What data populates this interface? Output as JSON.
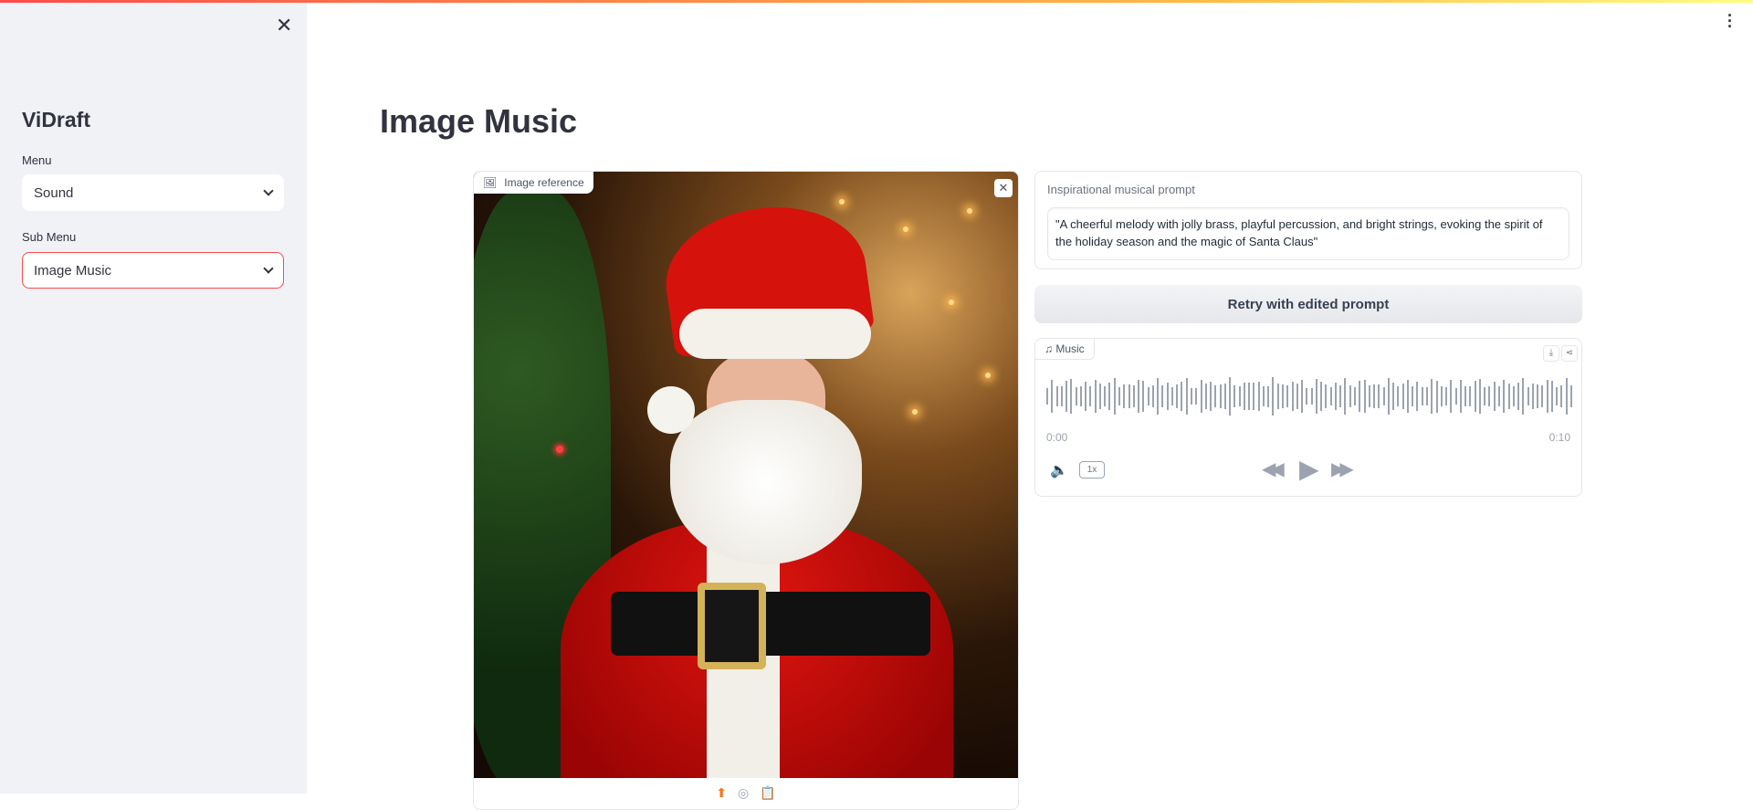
{
  "sidebar": {
    "brand": "ViDraft",
    "menu_label": "Menu",
    "menu_value": "Sound",
    "submenu_label": "Sub Menu",
    "submenu_value": "Image Music"
  },
  "page": {
    "title": "Image Music"
  },
  "image_panel": {
    "label": "Image reference"
  },
  "prompt": {
    "label": "Inspirational musical prompt",
    "value": "\"A cheerful melody with jolly brass, playful percussion, and bright strings, evoking the spirit of the holiday season and the magic of Santa Claus\""
  },
  "retry_button": "Retry with edited prompt",
  "audio": {
    "label": "Music",
    "current_time": "0:00",
    "duration": "0:10",
    "playback_rate": "1x",
    "progress": 0
  },
  "colors": {
    "accent": "#ff4b4b",
    "sidebar_bg": "#f0f2f6"
  }
}
